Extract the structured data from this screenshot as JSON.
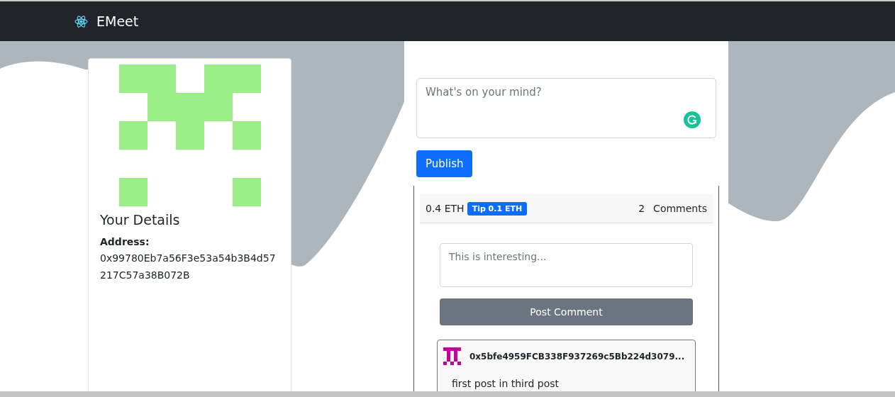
{
  "navbar": {
    "brand": "EMeet"
  },
  "profile": {
    "title": "Your Details",
    "address_label": "Address:",
    "address": "0x99780Eb7a56F3e53a54b3B4d57217C57a38B072B"
  },
  "composer": {
    "placeholder": "What's on your mind?",
    "button": "Publish"
  },
  "post": {
    "amount": "0.4 ETH",
    "tip_button": "Tip 0.1 ETH",
    "comment_count": "2",
    "comments_label": "Comments",
    "comment_field": {
      "placeholder": "This is interesting..."
    },
    "comment_button": "Post Comment",
    "comments": [
      {
        "author": "0x5bfe4959FCB338F937269c5Bb224d3079...",
        "text": "first post in third post"
      }
    ]
  }
}
